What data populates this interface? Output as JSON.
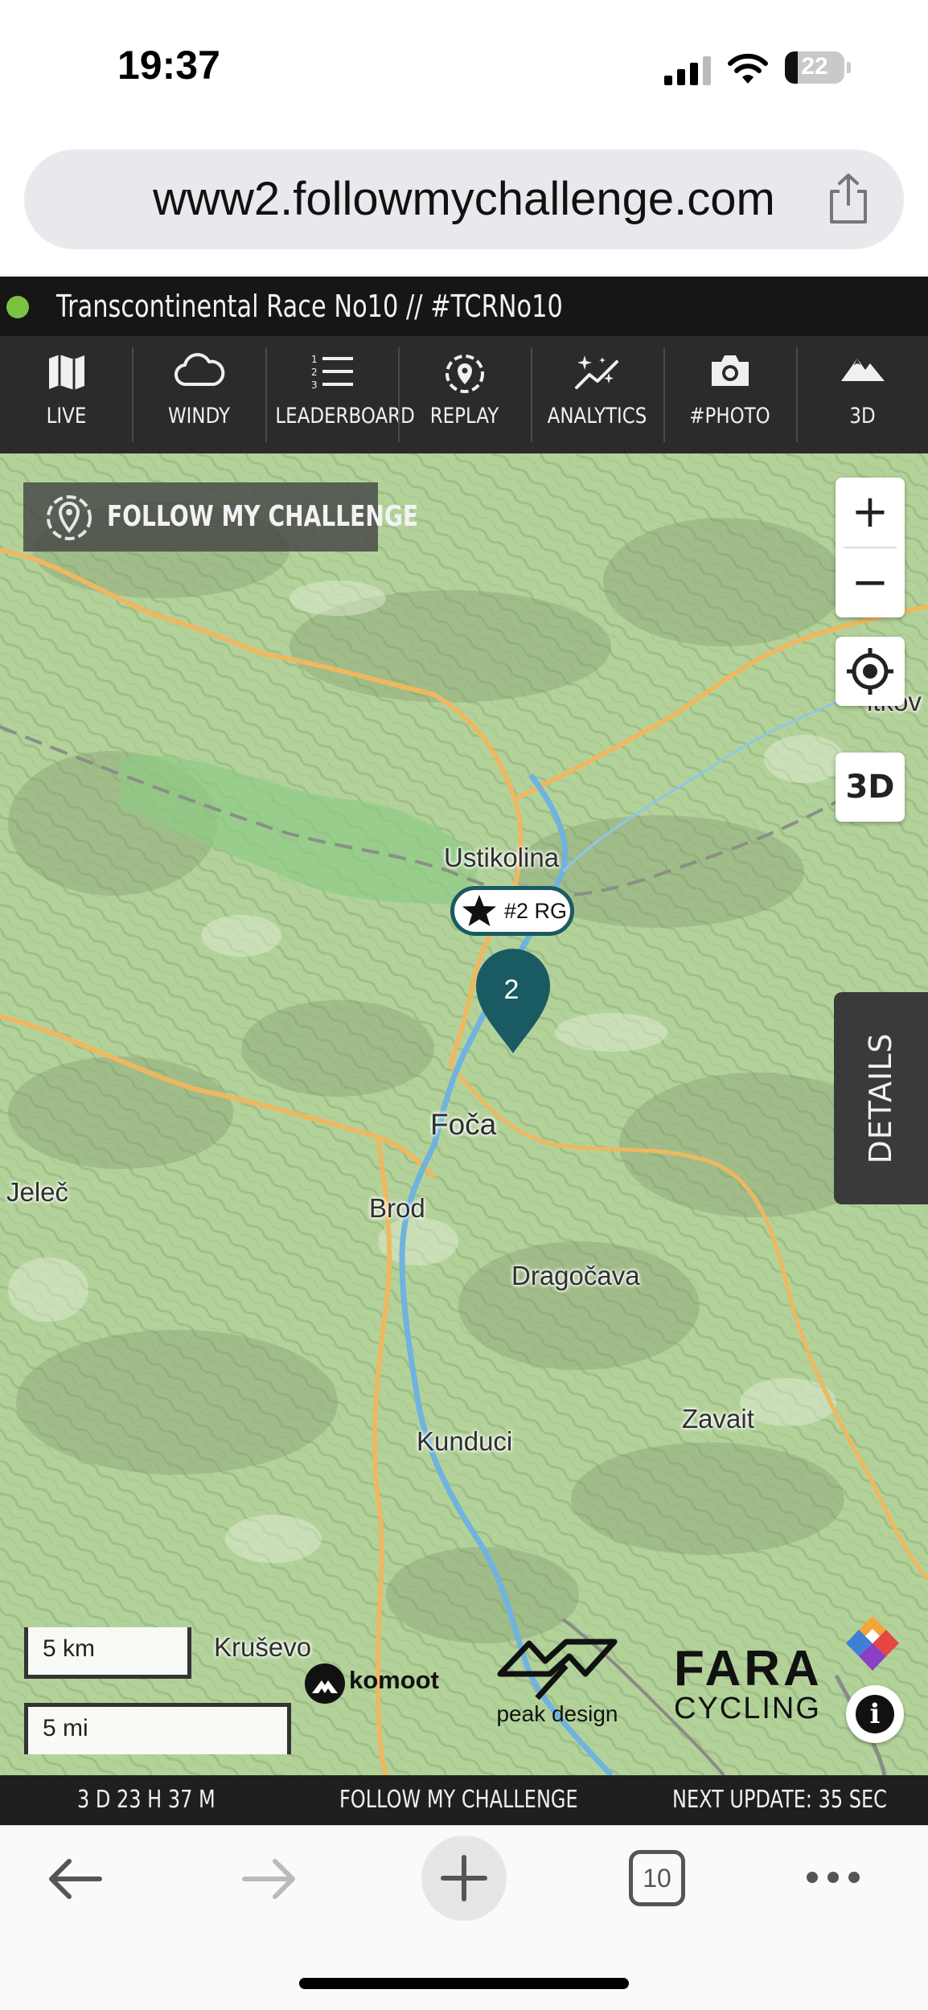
{
  "status_bar": {
    "time": "19:37",
    "battery_level": "22",
    "battery_fraction": 0.22
  },
  "browser": {
    "url": "www2.followmychallenge.com",
    "tab_count": "10"
  },
  "page": {
    "race_title": "Transcontinental Race No10 // #TCRNo10",
    "live_indicator_color": "#7cc242"
  },
  "toolbar": {
    "items": [
      {
        "label": "LIVE",
        "icon": "map-icon"
      },
      {
        "label": "WINDY",
        "icon": "cloud-icon"
      },
      {
        "label": "LEADERBOARD",
        "icon": "list-icon"
      },
      {
        "label": "REPLAY",
        "icon": "replay-target-icon"
      },
      {
        "label": "ANALYTICS",
        "icon": "sparkle-chart-icon"
      },
      {
        "label": "#PHOTO",
        "icon": "camera-icon"
      },
      {
        "label": "3D",
        "icon": "mountain-icon"
      }
    ]
  },
  "map": {
    "logo_text": "FOLLOW MY CHALLENGE",
    "zoom_in_label": "+",
    "zoom_out_label": "−",
    "view_3d_label": "3D",
    "details_label": "DETAILS",
    "places": [
      "Ustikolina",
      "Foča",
      "Jeleč",
      "Brod",
      "Dragočava",
      "Zavait",
      "Kunduci",
      "Kruševo",
      "itkov"
    ],
    "rider": {
      "label": "#2 RG",
      "pin_number": "2",
      "pin_color": "#1a5a63"
    },
    "scale": {
      "km": "5 km",
      "mi": "5 mi"
    },
    "sponsors": {
      "komoot": "komoot",
      "peakdesign": "peak design",
      "fara": "FARA",
      "fara_sub": "CYCLING"
    },
    "info_label": "i"
  },
  "footer": {
    "elapsed": "3 D 23 H 37 M",
    "brand": "FOLLOW MY CHALLENGE",
    "next_update": "NEXT UPDATE: 35 SEC"
  }
}
